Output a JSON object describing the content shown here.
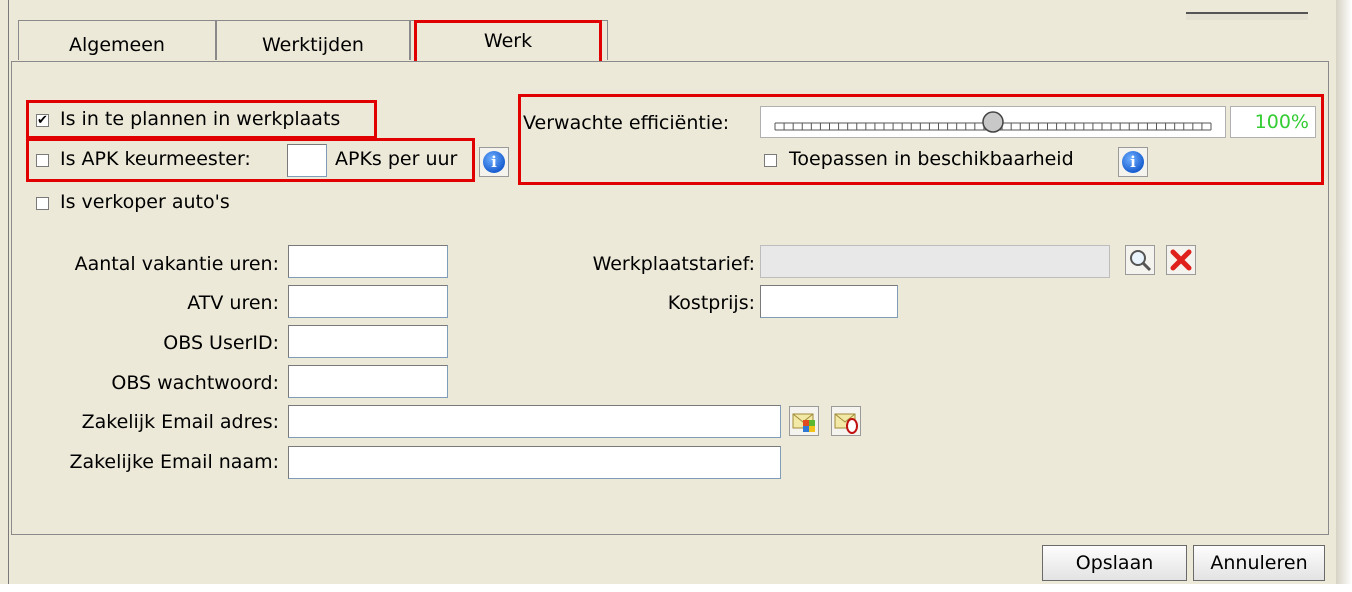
{
  "tabs": [
    {
      "label": "Algemeen"
    },
    {
      "label": "Werktijden"
    },
    {
      "label": "Werk"
    }
  ],
  "checkboxes": {
    "plannen": {
      "label": "Is in te plannen in werkplaats",
      "checked": true
    },
    "apk": {
      "label": "Is APK keurmeester:",
      "checked": false
    },
    "verkoper": {
      "label": "Is verkoper auto's",
      "checked": false
    },
    "toepassen": {
      "label": "Toepassen in beschikbaarheid",
      "checked": false
    }
  },
  "apk_suffix": "APKs per uur",
  "apk_value": "",
  "efficiency": {
    "label": "Verwachte efficiëntie:",
    "value_text": "100%",
    "slider_fraction": 0.5
  },
  "fields": {
    "vakantie": {
      "label": "Aantal vakantie uren:",
      "value": ""
    },
    "atv": {
      "label": "ATV uren:",
      "value": ""
    },
    "obs_user": {
      "label": "OBS UserID:",
      "value": ""
    },
    "obs_pass": {
      "label": "OBS wachtwoord:",
      "value": ""
    },
    "email_adres": {
      "label": "Zakelijk Email adres:",
      "value": ""
    },
    "email_naam": {
      "label": "Zakelijke Email naam:",
      "value": ""
    },
    "werkplaatstarief": {
      "label": "Werkplaatstarief:",
      "value": ""
    },
    "kostprijs": {
      "label": "Kostprijs:",
      "value": ""
    }
  },
  "check_mark": "✔",
  "buttons": {
    "opslaan": "Opslaan",
    "annuleren": "Annuleren"
  },
  "icons": [
    "info-icon",
    "search-icon",
    "delete-icon",
    "email-client-icon",
    "email-test-icon"
  ],
  "colors": {
    "highlight": "#e00000",
    "percentage": "#33cc33"
  }
}
